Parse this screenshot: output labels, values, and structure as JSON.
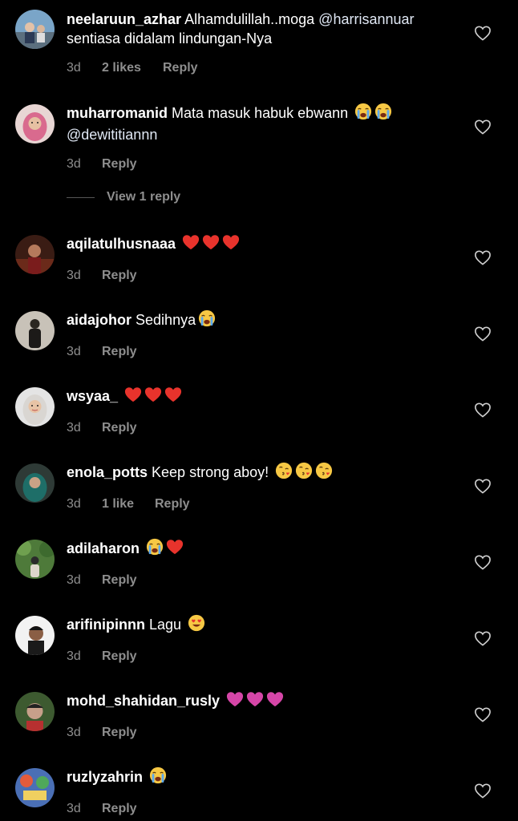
{
  "colors": {
    "background": "#000000",
    "text": "#ffffff",
    "secondary": "#8e8e8e",
    "mention": "#e0e8f5"
  },
  "comments": [
    {
      "username": "neelaruun_azhar",
      "text": "Alhamdulillah..moga ",
      "mention": "@harrisannuar",
      "text2": "sentiasa didalam lindungan-Nya",
      "time": "3d",
      "likes": "2 likes",
      "reply": "Reply",
      "emojis": []
    },
    {
      "username": "muharromanid",
      "text": "Mata masuk habuk ebwann",
      "mention": "@dewititiannn",
      "time": "3d",
      "likes": "",
      "reply": "Reply",
      "emojis": [
        "crying",
        "crying"
      ]
    },
    {
      "username": "aqilatulhusnaaa",
      "text": "",
      "time": "3d",
      "likes": "",
      "reply": "Reply",
      "emojis": [
        "heart",
        "heart",
        "heart"
      ]
    },
    {
      "username": "aidajohor",
      "text": "Sedihnya",
      "time": "3d",
      "likes": "",
      "reply": "Reply",
      "emojis": [
        "crying"
      ]
    },
    {
      "username": "wsyaa_",
      "text": "",
      "time": "3d",
      "likes": "",
      "reply": "Reply",
      "emojis": [
        "heart",
        "heart",
        "heart"
      ]
    },
    {
      "username": "enola_potts",
      "text": "Keep strong aboy!",
      "time": "3d",
      "likes": "1 like",
      "reply": "Reply",
      "emojis": [
        "kiss",
        "kiss",
        "kiss"
      ]
    },
    {
      "username": "adilaharon",
      "text": "",
      "time": "3d",
      "likes": "",
      "reply": "Reply",
      "emojis": [
        "crying",
        "heart"
      ]
    },
    {
      "username": "arifinipinnn",
      "text": "Lagu",
      "time": "3d",
      "likes": "",
      "reply": "Reply",
      "emojis": [
        "hearteyes"
      ]
    },
    {
      "username": "mohd_shahidan_rusly",
      "text": "",
      "time": "3d",
      "likes": "",
      "reply": "Reply",
      "emojis": [
        "purpleheart",
        "purpleheart",
        "purpleheart"
      ]
    },
    {
      "username": "ruzlyzahrin",
      "text": "",
      "time": "3d",
      "likes": "",
      "reply": "Reply",
      "emojis": [
        "crying"
      ]
    }
  ],
  "view_replies": {
    "label": "View 1 reply"
  }
}
